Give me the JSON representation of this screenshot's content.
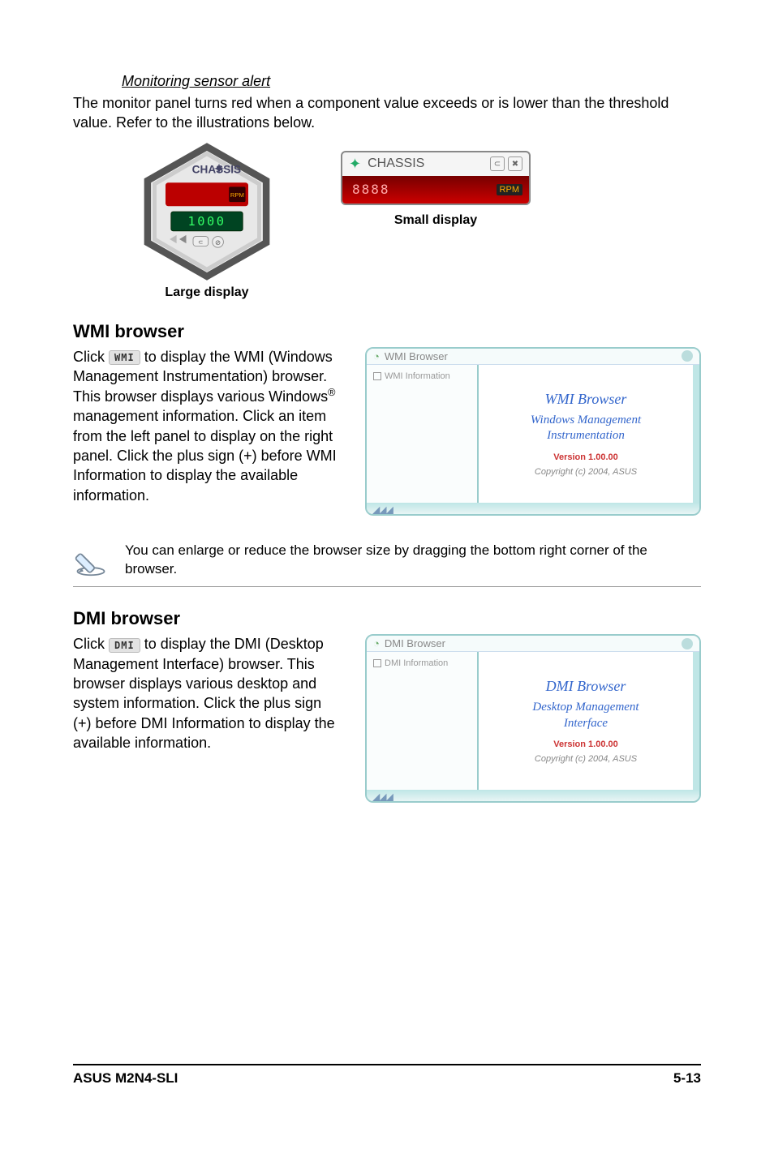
{
  "sensor_alert": {
    "heading": "Monitoring sensor alert",
    "para": "The monitor panel turns red when a component value exceeds or is lower than the threshold value. Refer to the illustrations below."
  },
  "hex": {
    "title": "CHASSIS",
    "rpm": "RPM",
    "digits": "1000"
  },
  "captions": {
    "large": "Large display",
    "small": "Small display"
  },
  "small": {
    "title": "CHASSIS",
    "digits": "8888",
    "rpm": "RPM"
  },
  "wmi": {
    "heading": "WMI browser",
    "btn": "WMI",
    "para_pre": "Click ",
    "para_post": " to display the WMI (Windows Management Instrumentation) browser. This browser displays various Windows",
    "para_tail": " management information. Click an item from the left panel to display on the right panel. Click the plus sign (+) before WMI Information to display the available information.",
    "win_title": "WMI Browser",
    "tree": "WMI Information",
    "main1": "WMI  Browser",
    "main2": "Windows Management Instrumentation",
    "ver": "Version 1.00.00",
    "copy": "Copyright (c) 2004,  ASUS"
  },
  "note": "You can enlarge or reduce the browser size by dragging the bottom right corner of the browser.",
  "dmi": {
    "heading": "DMI browser",
    "btn": "DMI",
    "para_pre": "Click ",
    "para_post": " to display the DMI (Desktop Management Interface) browser. This browser displays various desktop and system information. Click the plus sign (+) before DMI Information to display the available information.",
    "win_title": "DMI Browser",
    "tree": "DMI Information",
    "main1": "DMI  Browser",
    "main2": "Desktop Management Interface",
    "ver": "Version 1.00.00",
    "copy": "Copyright (c) 2004,  ASUS"
  },
  "footer": {
    "left": "ASUS M2N4-SLI",
    "right": "5-13"
  }
}
